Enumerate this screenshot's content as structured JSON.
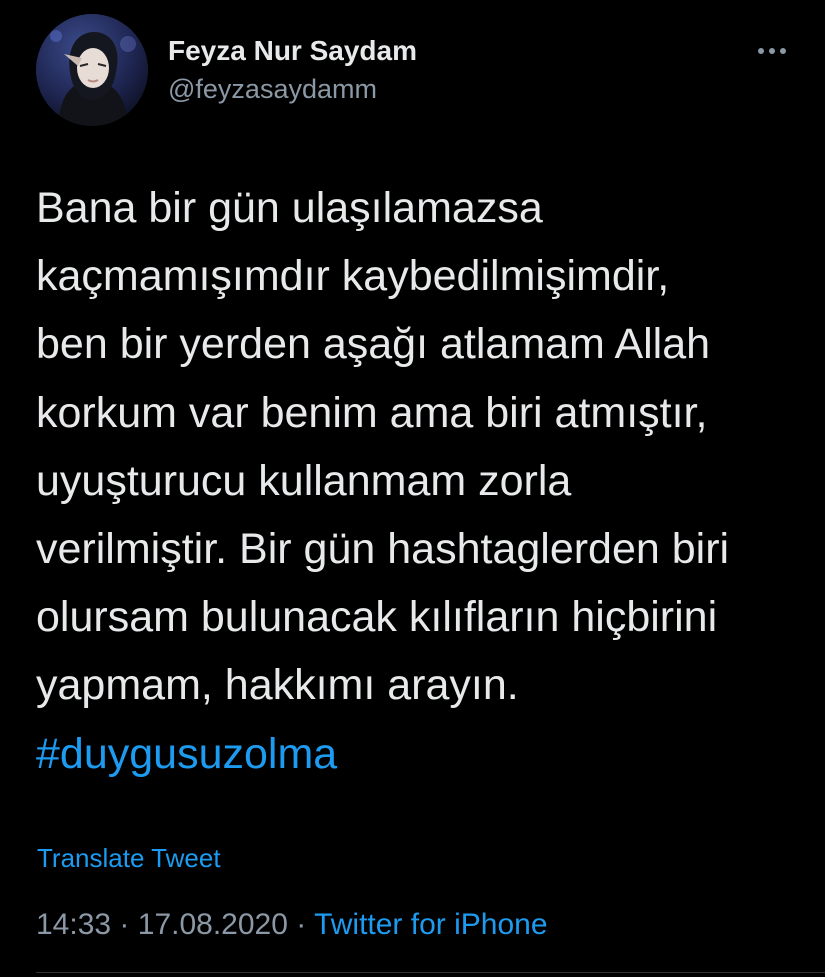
{
  "user": {
    "display_name": "Feyza Nur Saydam",
    "handle": "@feyzasaydamm"
  },
  "tweet": {
    "lines": [
      "Bana bir gün ulaşılamazsa",
      "kaçmamışımdır kaybedilmişimdir,",
      "ben bir yerden aşağı atlamam Allah",
      "korkum var  benim ama biri atmıştır,",
      "uyuşturucu kullanmam zorla",
      "verilmiştir. Bir gün hashtaglerden biri",
      "olursam bulunacak kılıfların hiçbirini",
      "yapmam, hakkımı arayın."
    ],
    "hashtag": "#duygusuzolma",
    "translate_label": "Translate Tweet",
    "time": "14:33",
    "separator": "·",
    "date": "17.08.2020",
    "source": "Twitter for iPhone"
  },
  "icons": {
    "more": "more-horizontal-icon"
  },
  "colors": {
    "background": "#000000",
    "text": "#e7e9ea",
    "secondary": "#8b98a5",
    "accent": "#1d9bf0"
  }
}
